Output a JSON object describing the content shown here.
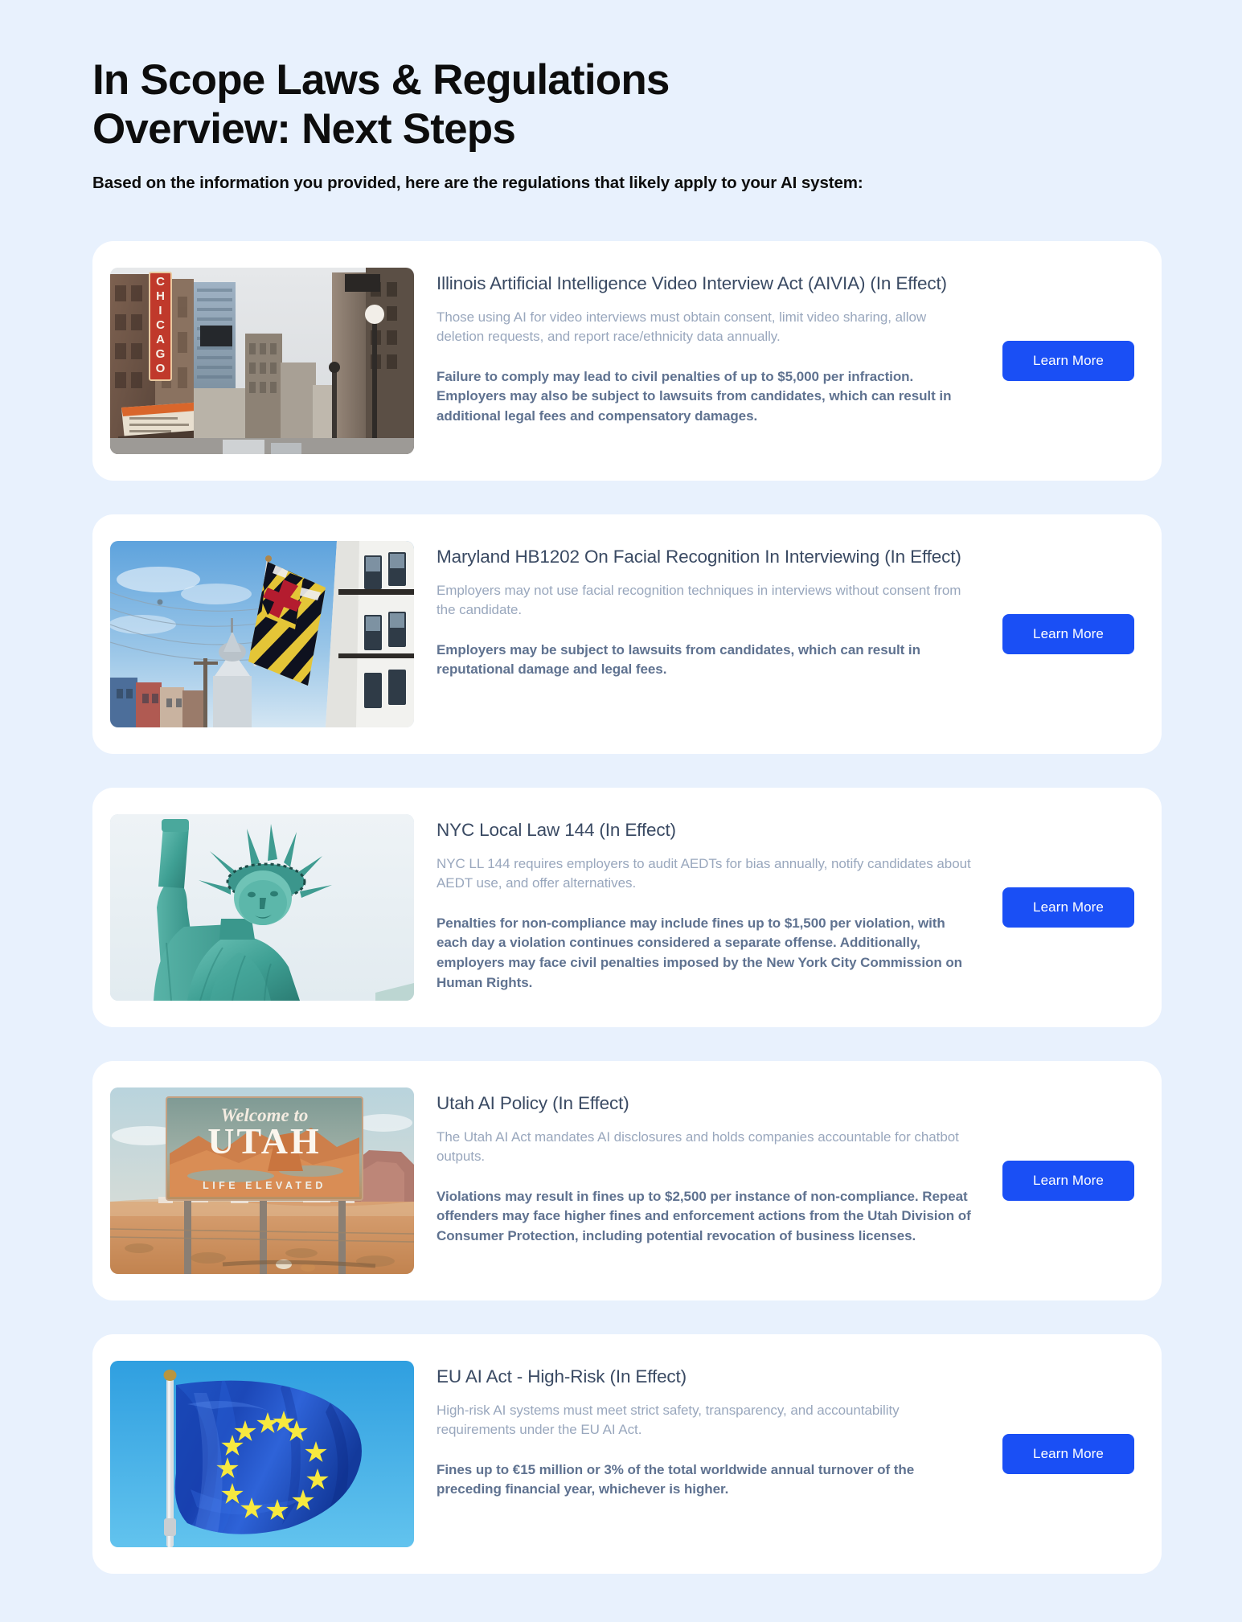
{
  "header": {
    "title_line1": "In Scope Laws & Regulations",
    "title_line2": "Overview: Next Steps",
    "subtitle": "Based on the information you provided, here are the regulations that likely apply to your AI system:"
  },
  "theme": {
    "page_background": "#e8f1fd",
    "card_background": "#ffffff",
    "button_color": "#1a4ff5",
    "title_color": "#3a4a63",
    "description_color": "#99a7bd",
    "penalty_color": "#5f7290"
  },
  "cards": [
    {
      "title": "Illinois Artificial Intelligence Video Interview Act (AIVIA) (In Effect)",
      "description": "Those using AI for video interviews must obtain consent, limit video sharing, allow deletion requests, and report race/ethnicity data annually.",
      "penalty": "Failure to comply may lead to civil penalties of up to $5,000 per infraction. Employers may also be subject to lawsuits from candidates, which can result in additional legal fees and compensatory damages.",
      "button_label": "Learn More",
      "image_name": "chicago-theatre-street-photo",
      "image_alt": "Chicago Theatre marquee on a city street"
    },
    {
      "title": "Maryland HB1202 On Facial Recognition In Interviewing (In Effect)",
      "description": "Employers may not use facial recognition techniques in interviews without consent from the candidate.",
      "penalty": "Employers may be subject to lawsuits from candidates, which can result in reputational damage and legal fees.",
      "button_label": "Learn More",
      "image_name": "maryland-flag-annapolis-photo",
      "image_alt": "Maryland state flag flying in Annapolis with the State House dome"
    },
    {
      "title": "NYC Local Law 144 (In Effect)",
      "description": "NYC LL 144 requires employers to audit AEDTs for bias annually, notify candidates about AEDT use, and offer alternatives.",
      "penalty": "Penalties for non-compliance may include fines up to $1,500 per violation, with each day a violation continues considered a separate offense. Additionally, employers may face civil penalties imposed by the New York City Commission on Human Rights.",
      "button_label": "Learn More",
      "image_name": "statue-of-liberty-photo",
      "image_alt": "Statue of Liberty against a pale sky"
    },
    {
      "title": "Utah AI Policy (In Effect)",
      "description": "The Utah AI Act mandates AI disclosures and holds companies accountable for chatbot outputs.",
      "penalty": "Violations may result in fines up to $2,500 per instance of non-compliance. Repeat offenders may face higher fines and enforcement actions from the Utah Division of Consumer Protection, including potential revocation of business licenses.",
      "button_label": "Learn More",
      "image_name": "welcome-to-utah-sign-photo",
      "image_alt": "Welcome to Utah Life Elevated roadside sign in the desert"
    },
    {
      "title": "EU AI Act - High-Risk (In Effect)",
      "description": "High-risk AI systems must meet strict safety, transparency, and accountability requirements under the EU AI Act.",
      "penalty": "Fines up to €15 million or 3% of the total worldwide annual turnover of the preceding financial year, whichever is higher.",
      "button_label": "Learn More",
      "image_name": "european-union-flag-photo",
      "image_alt": "European Union flag waving against a blue sky"
    }
  ]
}
